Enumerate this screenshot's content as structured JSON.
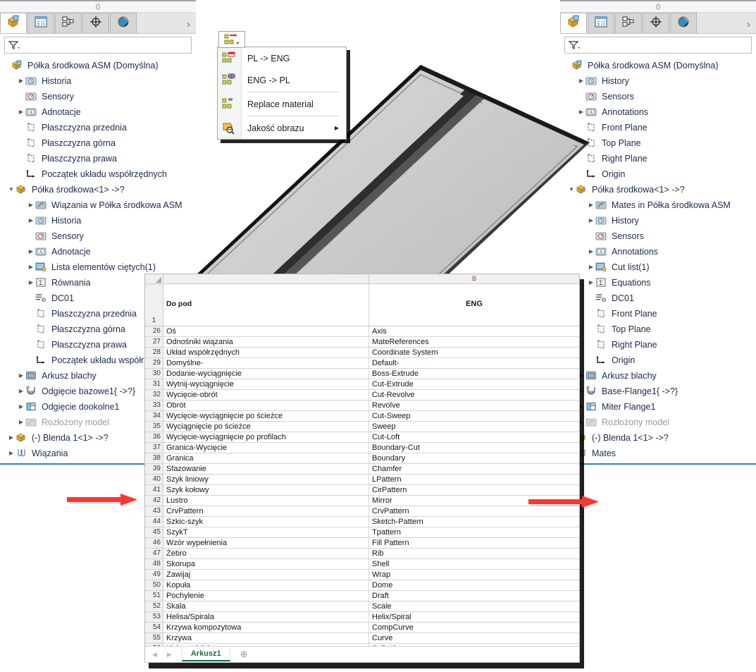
{
  "left_panel": {
    "tabs": [
      {
        "name": "feature-manager-design-tree",
        "icon": "yellow-box-icon",
        "active": true
      },
      {
        "name": "property-manager",
        "icon": "property-list-icon",
        "active": false
      },
      {
        "name": "configuration-manager",
        "icon": "configuration-icon",
        "active": false
      },
      {
        "name": "dimxpert-manager",
        "icon": "crosshair-icon",
        "active": false
      },
      {
        "name": "display-manager",
        "icon": "color-sphere-icon",
        "active": false
      }
    ],
    "more_label": "›",
    "filter": {
      "icon": "filter-funnel-icon",
      "placeholder": "",
      "value": ""
    },
    "root": {
      "label": "Półka środkowa ASM  (Domyślna)",
      "icon": "assembly-icon"
    },
    "items": [
      {
        "label": "Historia",
        "icon": "history-icon",
        "indent": 1,
        "twist": "closed"
      },
      {
        "label": "Sensory",
        "icon": "sensors-icon",
        "indent": 1,
        "twist": "none"
      },
      {
        "label": "Adnotacje",
        "icon": "annotations-icon",
        "indent": 1,
        "twist": "closed"
      },
      {
        "label": "Płaszczyzna przednia",
        "icon": "plane-icon",
        "indent": 1,
        "twist": "none"
      },
      {
        "label": "Płaszczyzna górna",
        "icon": "plane-icon",
        "indent": 1,
        "twist": "none"
      },
      {
        "label": "Płaszczyzna prawa",
        "icon": "plane-icon",
        "indent": 1,
        "twist": "none"
      },
      {
        "label": "Początek układu współrzędnych",
        "icon": "origin-icon",
        "indent": 1,
        "twist": "none"
      },
      {
        "label": "Półka środkowa<1> ->?",
        "icon": "part-icon",
        "indent": 0,
        "twist": "open"
      },
      {
        "label": "Wiązania w Półka środkowa ASM",
        "icon": "mates-folder-icon",
        "indent": 2,
        "twist": "closed"
      },
      {
        "label": "Historia",
        "icon": "history-icon",
        "indent": 2,
        "twist": "closed"
      },
      {
        "label": "Sensory",
        "icon": "sensors-icon",
        "indent": 2,
        "twist": "none"
      },
      {
        "label": "Adnotacje",
        "icon": "annotations-icon",
        "indent": 2,
        "twist": "closed"
      },
      {
        "label": "Lista elementów ciętych(1)",
        "icon": "cutlist-icon",
        "indent": 2,
        "twist": "closed"
      },
      {
        "label": "Równania",
        "icon": "equations-icon",
        "indent": 2,
        "twist": "closed"
      },
      {
        "label": "DC01",
        "icon": "material-icon",
        "indent": 2,
        "twist": "none"
      },
      {
        "label": "Płaszczyzna przednia",
        "icon": "plane-icon",
        "indent": 2,
        "twist": "none"
      },
      {
        "label": "Płaszczyzna górna",
        "icon": "plane-icon",
        "indent": 2,
        "twist": "none"
      },
      {
        "label": "Płaszczyzna prawa",
        "icon": "plane-icon",
        "indent": 2,
        "twist": "none"
      },
      {
        "label": "Początek układu współrzędnych",
        "icon": "origin-icon",
        "indent": 2,
        "twist": "none"
      },
      {
        "label": "Arkusz blachy",
        "icon": "sheetmetal-icon",
        "indent": 1,
        "twist": "closed"
      },
      {
        "label": "Odgięcie bazowe1{ ->?}",
        "icon": "base-flange-icon",
        "indent": 1,
        "twist": "closed"
      },
      {
        "label": "Odgięcie dookolne1",
        "icon": "miter-flange-icon",
        "indent": 1,
        "twist": "closed"
      },
      {
        "label": "Rozłożony model",
        "icon": "flat-pattern-icon",
        "indent": 1,
        "twist": "closed",
        "dim": true
      },
      {
        "label": "(-) Blenda 1<1> ->?",
        "icon": "part-icon",
        "indent": 0,
        "twist": "closed"
      },
      {
        "label": "Wiązania",
        "icon": "mates-icon",
        "indent": 0,
        "twist": "closed"
      }
    ]
  },
  "right_panel": {
    "tabs": [
      {
        "name": "feature-manager-design-tree",
        "icon": "yellow-box-icon",
        "active": true
      },
      {
        "name": "property-manager",
        "icon": "property-list-icon",
        "active": false
      },
      {
        "name": "configuration-manager",
        "icon": "configuration-icon",
        "active": false
      },
      {
        "name": "dimxpert-manager",
        "icon": "crosshair-icon",
        "active": false
      },
      {
        "name": "display-manager",
        "icon": "color-sphere-icon",
        "active": false
      }
    ],
    "more_label": "›",
    "filter": {
      "icon": "filter-funnel-icon",
      "placeholder": "",
      "value": ""
    },
    "root": {
      "label": "Półka środkowa ASM  (Domyślna)",
      "icon": "assembly-icon"
    },
    "items": [
      {
        "label": "History",
        "icon": "history-icon",
        "indent": 1,
        "twist": "closed"
      },
      {
        "label": "Sensors",
        "icon": "sensors-icon",
        "indent": 1,
        "twist": "none"
      },
      {
        "label": "Annotations",
        "icon": "annotations-icon",
        "indent": 1,
        "twist": "closed"
      },
      {
        "label": "Front Plane",
        "icon": "plane-icon",
        "indent": 1,
        "twist": "none"
      },
      {
        "label": "Top Plane",
        "icon": "plane-icon",
        "indent": 1,
        "twist": "none"
      },
      {
        "label": "Right Plane",
        "icon": "plane-icon",
        "indent": 1,
        "twist": "none"
      },
      {
        "label": "Origin",
        "icon": "origin-icon",
        "indent": 1,
        "twist": "none"
      },
      {
        "label": "Półka środkowa<1> ->?",
        "icon": "part-icon",
        "indent": 0,
        "twist": "open"
      },
      {
        "label": "Mates in Półka środkowa ASM",
        "icon": "mates-folder-icon",
        "indent": 2,
        "twist": "closed"
      },
      {
        "label": "History",
        "icon": "history-icon",
        "indent": 2,
        "twist": "closed"
      },
      {
        "label": "Sensors",
        "icon": "sensors-icon",
        "indent": 2,
        "twist": "none"
      },
      {
        "label": "Annotations",
        "icon": "annotations-icon",
        "indent": 2,
        "twist": "closed"
      },
      {
        "label": "Cut list(1)",
        "icon": "cutlist-icon",
        "indent": 2,
        "twist": "closed"
      },
      {
        "label": "Equations",
        "icon": "equations-icon",
        "indent": 2,
        "twist": "closed"
      },
      {
        "label": "DC01",
        "icon": "material-icon",
        "indent": 2,
        "twist": "none"
      },
      {
        "label": "Front Plane",
        "icon": "plane-icon",
        "indent": 2,
        "twist": "none"
      },
      {
        "label": "Top Plane",
        "icon": "plane-icon",
        "indent": 2,
        "twist": "none"
      },
      {
        "label": "Right Plane",
        "icon": "plane-icon",
        "indent": 2,
        "twist": "none"
      },
      {
        "label": "Origin",
        "icon": "origin-icon",
        "indent": 2,
        "twist": "none"
      },
      {
        "label": "Arkusz blachy",
        "icon": "sheetmetal-icon",
        "indent": 1,
        "twist": "closed"
      },
      {
        "label": "Base-Flange1{ ->?}",
        "icon": "base-flange-icon",
        "indent": 1,
        "twist": "closed"
      },
      {
        "label": "Miter Flange1",
        "icon": "miter-flange-icon",
        "indent": 1,
        "twist": "closed"
      },
      {
        "label": "Rozłożony model",
        "icon": "flat-pattern-icon",
        "indent": 1,
        "twist": "closed",
        "dim": true
      },
      {
        "label": "(-) Blenda 1<1> ->?",
        "icon": "part-icon",
        "indent": 0,
        "twist": "none"
      },
      {
        "label": "Mates",
        "icon": "mates-icon",
        "indent": 0,
        "twist": "none"
      }
    ]
  },
  "context_menu": {
    "button_icon": "translate-tree-dropdown-icon",
    "items": [
      {
        "label": "PL -> ENG",
        "icon": "pl-to-eng-icon",
        "submenu": false
      },
      {
        "label": "ENG -> PL",
        "icon": "eng-to-pl-icon",
        "submenu": false
      },
      {
        "separator_after": true
      },
      {
        "label": "Replace material",
        "icon": "replace-material-icon",
        "submenu": false
      },
      {
        "separator_after": true
      },
      {
        "label": "Jakość obrazu",
        "icon": "image-quality-icon",
        "submenu": true
      }
    ]
  },
  "spreadsheet": {
    "column_headers": [
      "",
      "B"
    ],
    "header_row": {
      "number": "1",
      "a": "Do pod",
      "b": "ENG"
    },
    "rows": [
      {
        "n": "26",
        "a": "Oś",
        "b": "Axis"
      },
      {
        "n": "27",
        "a": "Odnośniki wiązania",
        "b": "MateReferences"
      },
      {
        "n": "28",
        "a": "Układ współrzędnych",
        "b": "Coordinate System"
      },
      {
        "n": "29",
        "a": "Domyślne-",
        "b": "Default-"
      },
      {
        "n": "30",
        "a": "Dodanie-wyciągnięcie",
        "b": "Boss-Extrude"
      },
      {
        "n": "31",
        "a": "Wytnij-wyciągnięcie",
        "b": "Cut-Extrude"
      },
      {
        "n": "32",
        "a": "Wycięcie-obrót",
        "b": "Cut-Revolve"
      },
      {
        "n": "33",
        "a": "Obrót",
        "b": "Revolve"
      },
      {
        "n": "34",
        "a": "Wycięcie-wyciągnięcie po ścieżce",
        "b": "Cut-Sweep"
      },
      {
        "n": "35",
        "a": "Wyciągnięcie po ścieżce",
        "b": "Sweep"
      },
      {
        "n": "36",
        "a": "Wycięcie-wyciągnięcie po profilach",
        "b": "Cut-Loft"
      },
      {
        "n": "37",
        "a": "Granica-Wycięcie",
        "b": "Boundary-Cut"
      },
      {
        "n": "38",
        "a": "Granica",
        "b": "Boundary"
      },
      {
        "n": "39",
        "a": "Sfazowanie",
        "b": "Chamfer"
      },
      {
        "n": "40",
        "a": "Szyk liniowy",
        "b": "LPattern"
      },
      {
        "n": "41",
        "a": "Szyk kołowy",
        "b": "CirPattern"
      },
      {
        "n": "42",
        "a": "Lustro",
        "b": "Mirror"
      },
      {
        "n": "43",
        "a": "CrvPattern",
        "b": "CrvPattern"
      },
      {
        "n": "44",
        "a": "Szkic-szyk",
        "b": "Sketch-Pattern"
      },
      {
        "n": "45",
        "a": "SzykT",
        "b": "Tpattern"
      },
      {
        "n": "46",
        "a": "Wzór wypełnienia",
        "b": "Fill Pattern"
      },
      {
        "n": "47",
        "a": "Żebro",
        "b": "Rib"
      },
      {
        "n": "48",
        "a": "Skorupa",
        "b": "Shell"
      },
      {
        "n": "49",
        "a": "Zawijaj",
        "b": "Wrap"
      },
      {
        "n": "50",
        "a": "Kopuła",
        "b": "Dome"
      },
      {
        "n": "51",
        "a": "Pochylenie",
        "b": "Draft"
      },
      {
        "n": "52",
        "a": "Skala",
        "b": "Scale"
      },
      {
        "n": "53",
        "a": "Helisa/Spirala",
        "b": "Helix/Spiral"
      },
      {
        "n": "54",
        "a": "Krzywa kompozytowa",
        "b": "CompCurve"
      },
      {
        "n": "55",
        "a": "Krzywa",
        "b": "Curve"
      },
      {
        "n": "56",
        "a": "Linia podziałowa",
        "b": "Split Line"
      }
    ],
    "sheet_tab": "Arkusz1",
    "add_sheet_label": "⊕",
    "nav_prev": "◀",
    "nav_next": "▶"
  },
  "annotations": {
    "arrow_color": "#ef3b34",
    "left_arrow": {
      "name": "left-red-arrow"
    },
    "right_arrow": {
      "name": "right-red-arrow"
    }
  },
  "model": {
    "name": "sheet-metal-shelf-3d-model",
    "body_color": "#c8c8c8",
    "edge_color": "#262626"
  }
}
